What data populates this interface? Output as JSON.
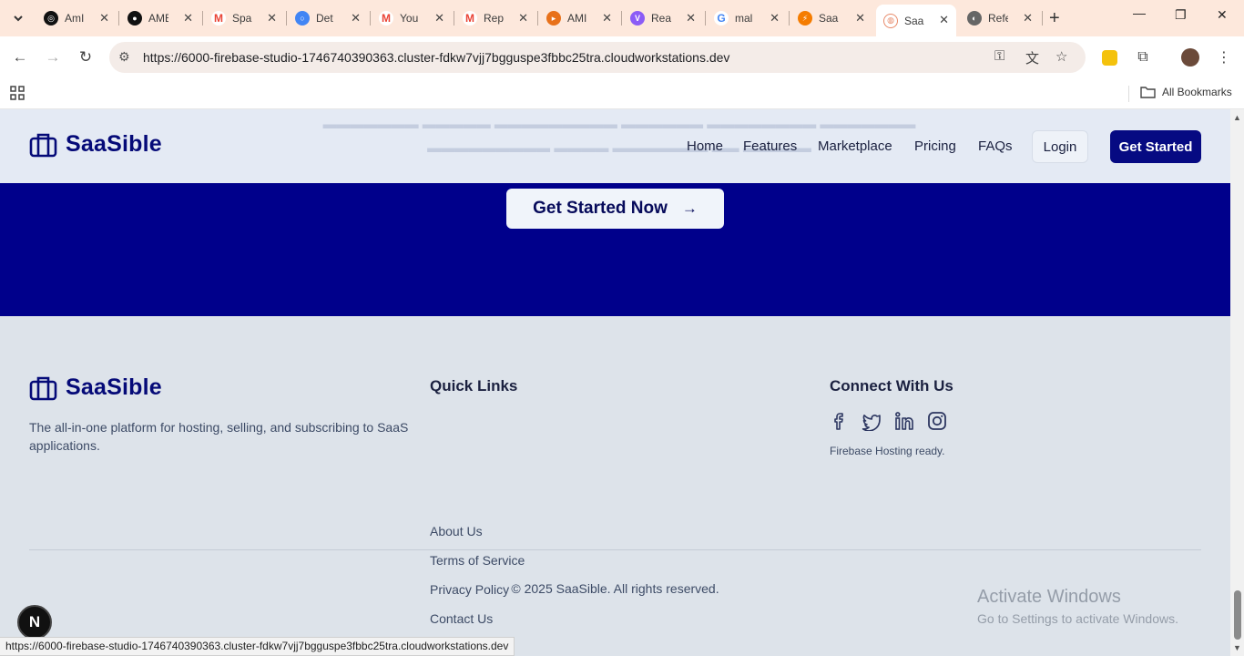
{
  "browser": {
    "tabs": [
      {
        "label": "AmI",
        "icon": "openai-icon",
        "color": "#111111"
      },
      {
        "label": "AME",
        "icon": "github-icon",
        "color": "#111111"
      },
      {
        "label": "Spa",
        "icon": "gmail-icon",
        "color": "#ea4335"
      },
      {
        "label": "Det",
        "icon": "chrome-icon",
        "color": "#4285f4"
      },
      {
        "label": "You",
        "icon": "gmail-icon",
        "color": "#ea4335"
      },
      {
        "label": "Rep",
        "icon": "gmail-icon",
        "color": "#ea4335"
      },
      {
        "label": "AMI",
        "icon": "app-icon",
        "color": "#e8711a"
      },
      {
        "label": "Rea",
        "icon": "vite-icon",
        "color": "#8b5cf6"
      },
      {
        "label": "mal",
        "icon": "google-icon",
        "color": "#4285f4"
      },
      {
        "label": "Saa",
        "icon": "firebase-icon",
        "color": "#f57c00"
      },
      {
        "label": "Saa",
        "icon": "studio-icon",
        "color": "#e88a6a",
        "active": true
      },
      {
        "label": "Refe",
        "icon": "globe-icon",
        "color": "#666666"
      }
    ],
    "url": "https://6000-firebase-studio-1746740390363.cluster-fdkw7vjj7bgguspe3fbbc25tra.cloudworkstations.dev",
    "bookmarks_label": "All Bookmarks",
    "status_url": "https://6000-firebase-studio-1746740390363.cluster-fdkw7vjj7bgguspe3fbbc25tra.cloudworkstations.dev"
  },
  "header": {
    "brand": "SaaSible",
    "nav": [
      "Home",
      "Features",
      "Marketplace",
      "Pricing",
      "FAQs"
    ],
    "login": "Login",
    "get_started": "Get Started"
  },
  "cta": {
    "button": "Get Started Now"
  },
  "footer": {
    "brand": "SaaSible",
    "description": "The all-in-one platform for hosting, selling, and subscribing to SaaS applications.",
    "quick_links_title": "Quick Links",
    "quick_links": [
      "About Us",
      "Terms of Service",
      "Privacy Policy",
      "Contact Us"
    ],
    "connect_title": "Connect With Us",
    "social": [
      "facebook-icon",
      "twitter-icon",
      "linkedin-icon",
      "instagram-icon"
    ],
    "hosting_note": "Firebase Hosting ready.",
    "copyright": "© 2025 SaaSible. All rights reserved."
  },
  "windows": {
    "activate_title": "Activate Windows",
    "activate_sub": "Go to Settings to activate Windows."
  },
  "overlay": {
    "badge": "N"
  },
  "colors": {
    "brand_navy": "#00008b",
    "button_navy": "#060a82",
    "page_bg": "#dde3ea",
    "chrome_tab_bg": "#fde8dc"
  }
}
